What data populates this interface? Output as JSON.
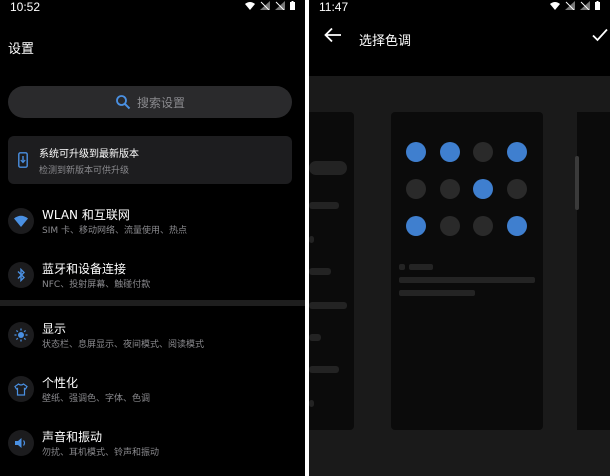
{
  "left_screen": {
    "status_time": "10:52",
    "title": "设置",
    "search_placeholder": "搜索设置",
    "update_card": {
      "title": "系统可升级到最新版本",
      "subtitle": "检测到新版本可供升级"
    },
    "items": [
      {
        "title": "WLAN 和互联网",
        "subtitle": "SIM 卡、移动网络、流量使用、热点",
        "icon": "wifi-icon"
      },
      {
        "title": "蓝牙和设备连接",
        "subtitle": "NFC、投射屏幕、触碰付款",
        "icon": "bluetooth-icon"
      },
      {
        "title": "显示",
        "subtitle": "状态栏、息屏显示、夜间模式、阅读模式",
        "icon": "brightness-icon"
      },
      {
        "title": "个性化",
        "subtitle": "壁纸、强调色、字体、色调",
        "icon": "shirt-icon"
      },
      {
        "title": "声音和振动",
        "subtitle": "勿扰、耳机模式、铃声和振动",
        "icon": "speaker-icon"
      }
    ]
  },
  "right_screen": {
    "status_time": "11:47",
    "title": "选择色调",
    "dot_grid": [
      [
        true,
        true,
        false,
        true
      ],
      [
        false,
        false,
        true,
        false
      ],
      [
        true,
        false,
        false,
        true
      ]
    ]
  },
  "colors": {
    "accent_blue": "#3f7fcf",
    "dot_off": "#2a2a2a",
    "icon_blue": "#4a90e2"
  }
}
